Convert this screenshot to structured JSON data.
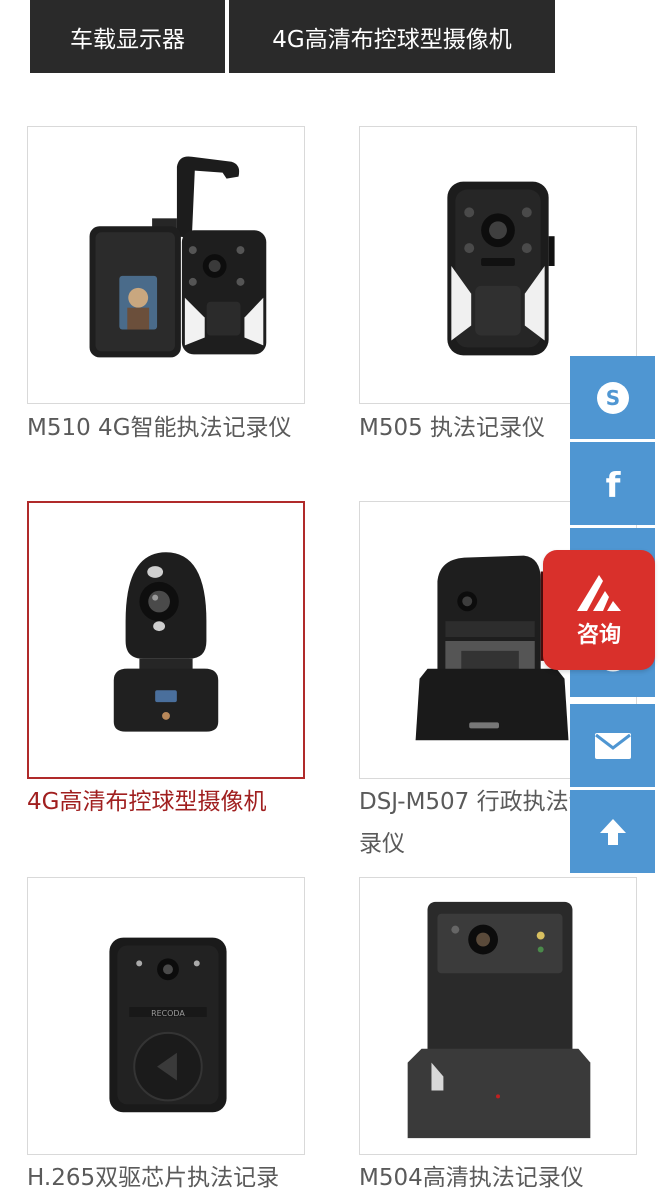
{
  "tabs": [
    {
      "label": "车载显示器"
    },
    {
      "label": "4G高清布控球型摄像机"
    }
  ],
  "products": [
    {
      "name": "M510 4G智能执法记录仪",
      "active": false
    },
    {
      "name": "M505 执法记录仪",
      "active": false
    },
    {
      "name": "4G高清布控球型摄像机",
      "active": true
    },
    {
      "name": "DSJ-M507 行政执法记录仪",
      "active": false
    },
    {
      "name": "H.265双驱芯片执法记录",
      "active": false
    },
    {
      "name": "M504高清执法记录仪",
      "active": false
    }
  ],
  "side_toolbar": {
    "buttons": [
      "skype-icon",
      "facebook-icon",
      "twitter-icon",
      "whatsapp-icon",
      "mail-icon",
      "arrow-up-icon"
    ],
    "consult_label": "咨询",
    "color": "#4f96d2",
    "consult_color": "#d9302b"
  },
  "colors": {
    "tab_bg": "#2a2a2a",
    "active_caption": "#a01f1f",
    "caption": "#5a5a5a"
  }
}
